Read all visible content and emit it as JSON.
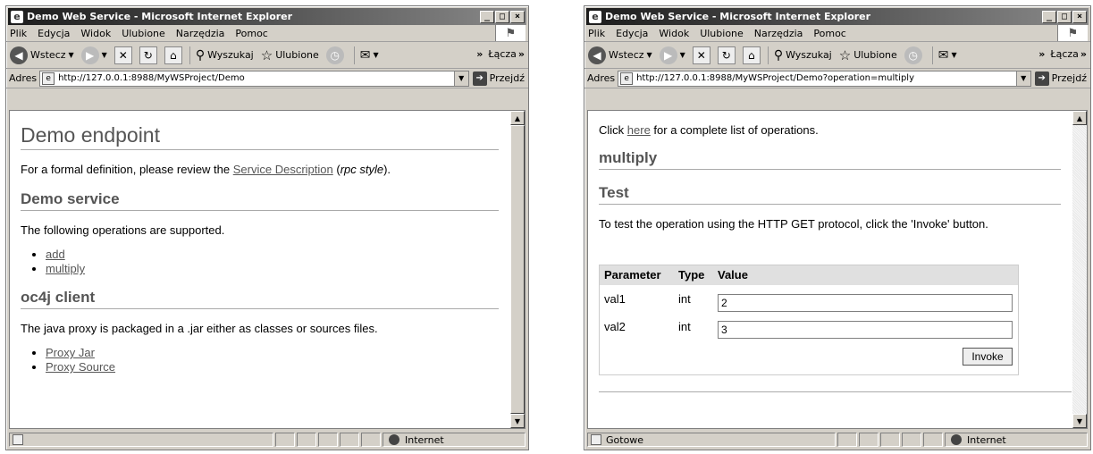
{
  "left": {
    "title": "Demo Web Service - Microsoft Internet Explorer",
    "menu": [
      "Plik",
      "Edycja",
      "Widok",
      "Ulubione",
      "Narzędzia",
      "Pomoc"
    ],
    "toolbar": {
      "back": "Wstecz",
      "search": "Wyszukaj",
      "favorites": "Ulubione",
      "links": "Łącza"
    },
    "address_label": "Adres",
    "address": "http://127.0.0.1:8988/MyWSProject/Demo",
    "go": "Przejdź",
    "page": {
      "h1": "Demo endpoint",
      "intro_prefix": "For a formal definition, please review the ",
      "intro_link": "Service Description",
      "intro_mid": " (",
      "intro_em": "rpc style",
      "intro_suffix": ").",
      "h2_service": "Demo service",
      "ops_text": "The following operations are supported.",
      "ops": [
        "add",
        "multiply"
      ],
      "h2_client": "oc4j client",
      "client_text": "The java proxy is packaged in a .jar either as classes or sources files.",
      "client_links": [
        "Proxy Jar",
        "Proxy Source"
      ]
    },
    "status": "",
    "zone": "Internet"
  },
  "right": {
    "title": "Demo Web Service - Microsoft Internet Explorer",
    "menu": [
      "Plik",
      "Edycja",
      "Widok",
      "Ulubione",
      "Narzędzia",
      "Pomoc"
    ],
    "toolbar": {
      "back": "Wstecz",
      "search": "Wyszukaj",
      "favorites": "Ulubione",
      "links": "Łącza"
    },
    "address_label": "Adres",
    "address": "http://127.0.0.1:8988/MyWSProject/Demo?operation=multiply",
    "go": "Przejdź",
    "page": {
      "click_prefix": "Click ",
      "click_link": "here",
      "click_suffix": " for a complete list of operations.",
      "h2_op": "multiply",
      "h2_test": "Test",
      "test_text": "To test the operation using the HTTP GET protocol, click the 'Invoke' button.",
      "col_param": "Parameter",
      "col_type": "Type",
      "col_value": "Value",
      "rows": [
        {
          "param": "val1",
          "type": "int",
          "value": "2"
        },
        {
          "param": "val2",
          "type": "int",
          "value": "3"
        }
      ],
      "invoke": "Invoke"
    },
    "status": "Gotowe",
    "zone": "Internet"
  }
}
